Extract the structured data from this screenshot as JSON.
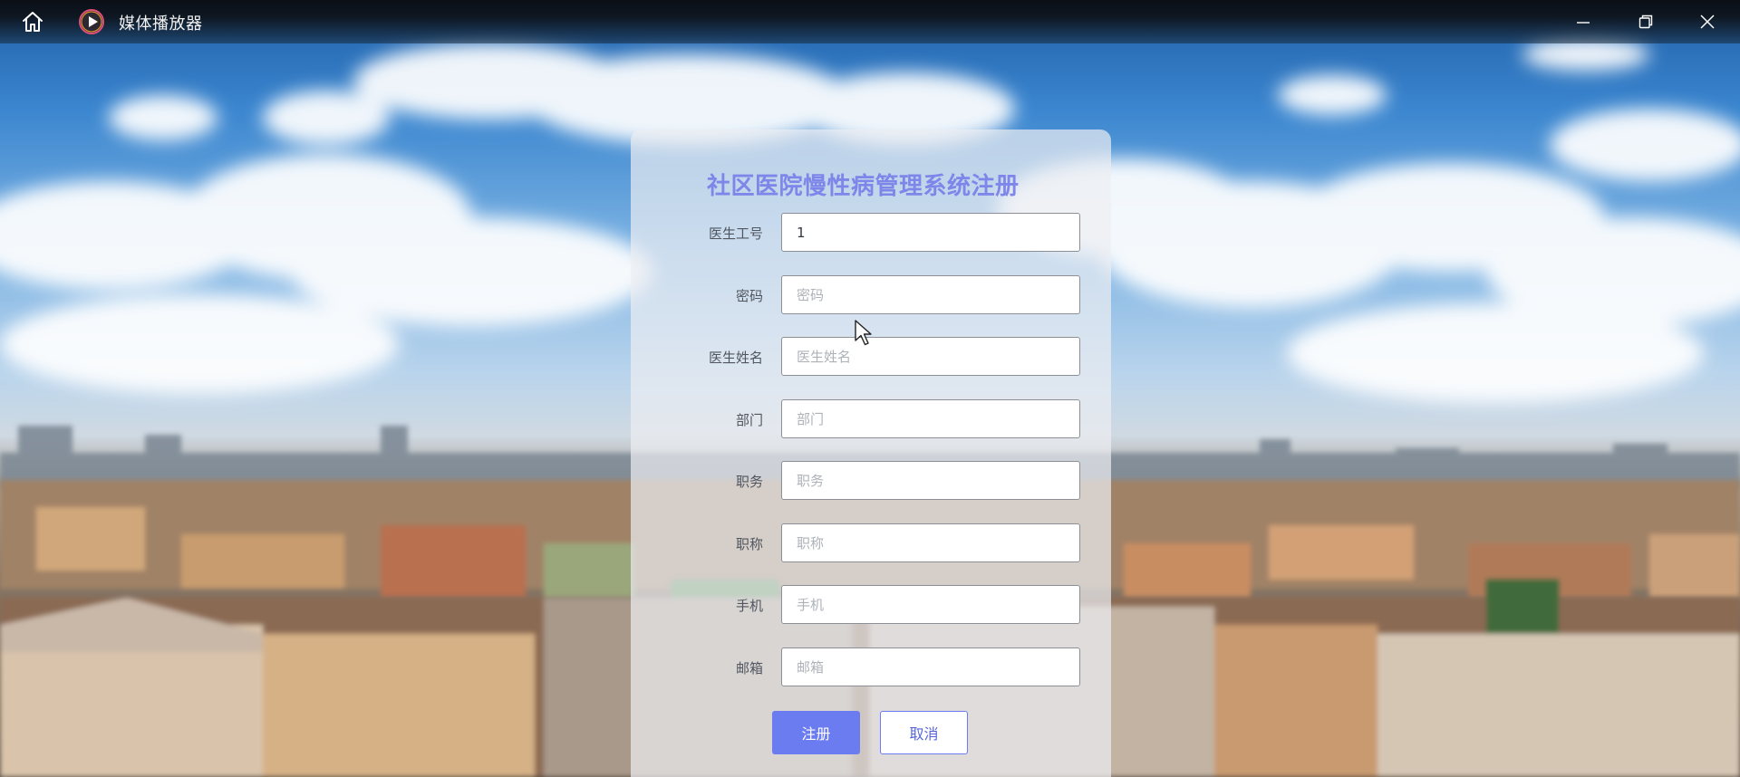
{
  "window": {
    "app_title": "媒体播放器",
    "icons": {
      "home": "home-icon",
      "app_logo": "play-icon",
      "minimize": "minimize-icon",
      "restore": "restore-icon",
      "close": "close-icon"
    }
  },
  "form": {
    "title": "社区医院慢性病管理系统注册",
    "fields": [
      {
        "key": "doctor_id",
        "label": "医生工号",
        "value": "1",
        "placeholder": ""
      },
      {
        "key": "password",
        "label": "密码",
        "value": "",
        "placeholder": "密码"
      },
      {
        "key": "doctor_name",
        "label": "医生姓名",
        "value": "",
        "placeholder": "医生姓名"
      },
      {
        "key": "department",
        "label": "部门",
        "value": "",
        "placeholder": "部门"
      },
      {
        "key": "position",
        "label": "职务",
        "value": "",
        "placeholder": "职务"
      },
      {
        "key": "title",
        "label": "职称",
        "value": "",
        "placeholder": "职称"
      },
      {
        "key": "phone",
        "label": "手机",
        "value": "",
        "placeholder": "手机"
      },
      {
        "key": "email",
        "label": "邮箱",
        "value": "",
        "placeholder": "邮箱"
      }
    ],
    "register_label": "注册",
    "cancel_label": "取消"
  },
  "colors": {
    "accent": "#6b7bf0",
    "title": "#7f86ea",
    "titlebar": "#0c0e12"
  }
}
